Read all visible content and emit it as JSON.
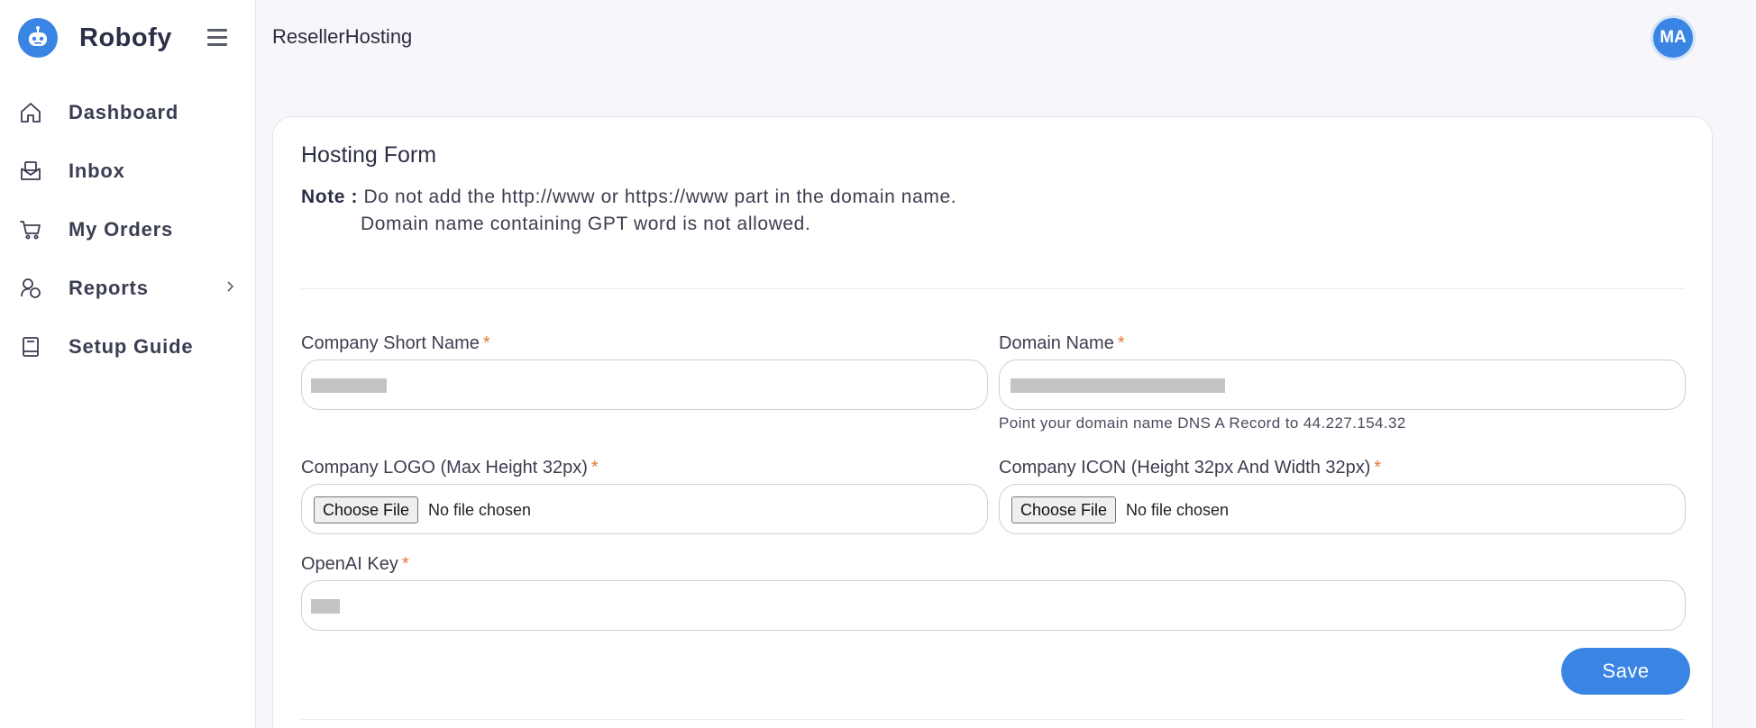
{
  "brand": {
    "name": "Robofy",
    "accent": "#3a85e3"
  },
  "sidebar": {
    "items": [
      {
        "label": "Dashboard",
        "icon": "home-icon"
      },
      {
        "label": "Inbox",
        "icon": "inbox-icon"
      },
      {
        "label": "My Orders",
        "icon": "cart-icon"
      },
      {
        "label": "Reports",
        "icon": "reports-icon"
      },
      {
        "label": "Setup Guide",
        "icon": "book-icon"
      }
    ]
  },
  "header": {
    "page_title": "ResellerHosting",
    "avatar_initials": "MA"
  },
  "form": {
    "title": "Hosting Form",
    "note_label": "Note :",
    "note_line1": "Do not add the http://www or https://www part in the domain name.",
    "note_line2": "Domain name containing GPT word is not allowed.",
    "required_mark": "*",
    "company_short_name": {
      "label": "Company Short Name"
    },
    "domain_name": {
      "label": "Domain Name",
      "hint": "Point your domain name DNS A Record to 44.227.154.32"
    },
    "company_logo": {
      "label": "Company LOGO (Max Height 32px)",
      "button": "Choose File",
      "status": "No file chosen"
    },
    "company_icon": {
      "label": "Company ICON (Height 32px And Width 32px)",
      "button": "Choose File",
      "status": "No file chosen"
    },
    "openai_key": {
      "label": "OpenAI Key"
    },
    "save_label": "Save"
  }
}
